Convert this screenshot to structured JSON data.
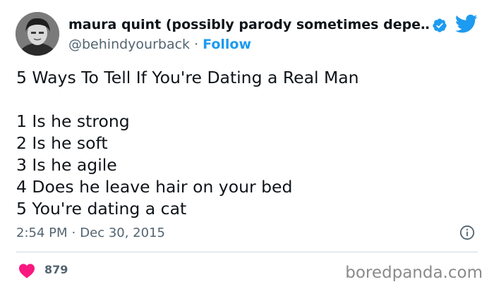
{
  "author": {
    "display_name": "maura quint (possibly parody sometimes depe…",
    "handle": "@behindyourback",
    "follow_label": "Follow",
    "verified": true
  },
  "tweet": {
    "title_line": "5 Ways To Tell If You're Dating a Real Man",
    "items": [
      "1 Is he strong",
      "2 Is he soft",
      "3 Is he agile",
      "4 Does he leave hair on your bed",
      "5 You're dating a cat"
    ],
    "time": "2:54 PM",
    "date": "Dec 30, 2015",
    "likes": "879"
  },
  "watermark": "boredpanda.com",
  "icons": {
    "verified": "verified-badge-icon",
    "brand": "twitter-bird-icon",
    "info": "info-icon",
    "like": "heart-icon"
  },
  "colors": {
    "accent": "#1d9bf0",
    "heart": "#f91880",
    "secondary_text": "#536471",
    "divider": "#cfd9de"
  }
}
